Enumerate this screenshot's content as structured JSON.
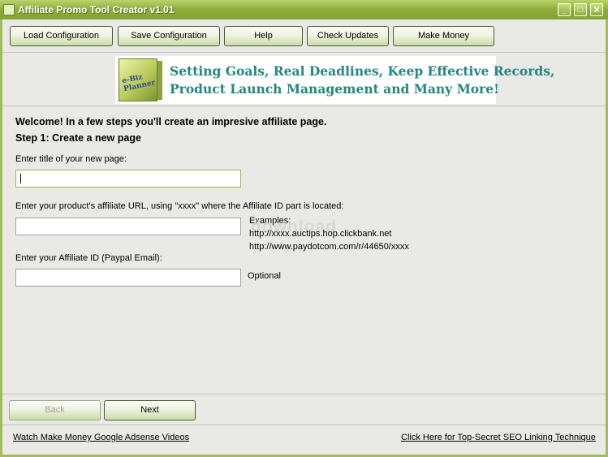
{
  "window": {
    "title": "Affiliate Promo Tool Creator v1.01",
    "controls": {
      "minimize": "_",
      "maximize": "□",
      "close": "×"
    }
  },
  "toolbar": {
    "load": "Load Configuration",
    "save": "Save Configuration",
    "help": "Help",
    "updates": "Check Updates",
    "money": "Make Money"
  },
  "banner": {
    "product_name": "e-Biz Planner",
    "line1": "Setting Goals, Real Deadlines, Keep Effective Records,",
    "line2": "Product Launch Management and Many More!"
  },
  "main": {
    "welcome": "Welcome! In a few steps you'll create an impresive affiliate page.",
    "step": "Step 1: Create a new page",
    "title_label": "Enter title of your new page:",
    "title_value": "",
    "url_label": "Enter your product's affiliate URL, using \"xxxx\" where the Affiliate ID part is located:",
    "url_value": "",
    "examples_label": "Examples:",
    "example1": "http://xxxx.auctips.hop.clickbank.net",
    "example2": "http://www.paydotcom.com/r/44650/xxxx",
    "id_label": "Enter your Affiliate ID (Paypal Email):",
    "id_value": "",
    "optional": "Optional"
  },
  "watermark": "download",
  "nav": {
    "back": "Back",
    "next": "Next"
  },
  "footer": {
    "left_link": "Watch Make Money Google Adsense Videos",
    "right_link": "Click Here for Top-Secret SEO Linking Technique"
  },
  "colors": {
    "titlebar": "#8fab3a",
    "banner_text": "#23887e",
    "frame": "#a3bc5a"
  }
}
